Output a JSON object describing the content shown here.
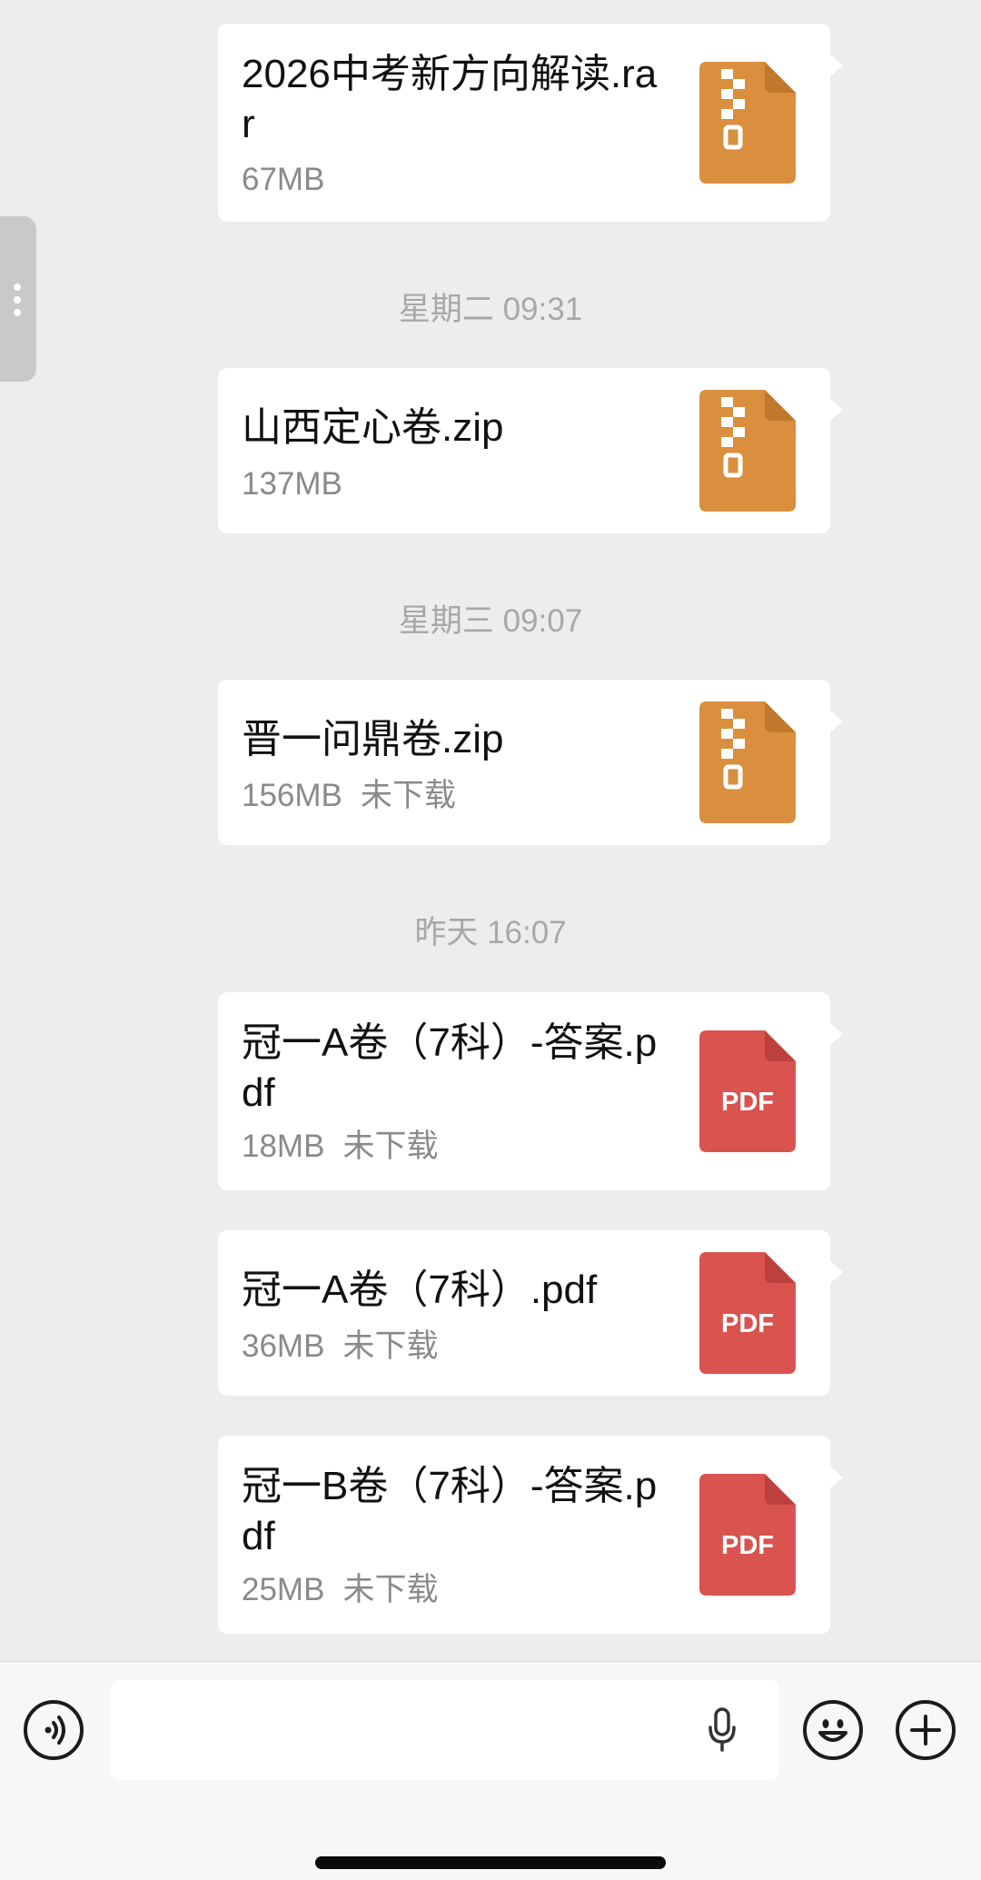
{
  "colors": {
    "chat_background": "#ededed",
    "bubble": "#ffffff",
    "zip_icon": "#d98f3d",
    "pdf_icon": "#d9534f",
    "timestamp": "#a8a8a8",
    "meta_text": "#8a8a8a"
  },
  "messages": [
    {
      "filename": "2026中考新方向解读.rar",
      "size": "67MB",
      "status": "",
      "icon": "zip-archive-icon"
    },
    {
      "filename": "山西定心卷.zip",
      "size": "137MB",
      "status": "",
      "icon": "zip-archive-icon"
    },
    {
      "filename": "晋一问鼎卷.zip",
      "size": "156MB",
      "status": "未下载",
      "icon": "zip-archive-icon"
    },
    {
      "filename": "冠一A卷（7科）-答案.pdf",
      "size": "18MB",
      "status": "未下载",
      "icon": "pdf-file-icon"
    },
    {
      "filename": "冠一A卷（7科）.pdf",
      "size": "36MB",
      "status": "未下载",
      "icon": "pdf-file-icon"
    },
    {
      "filename": "冠一B卷（7科）-答案.pdf",
      "size": "25MB",
      "status": "未下载",
      "icon": "pdf-file-icon"
    }
  ],
  "timestamps": [
    "星期二 09:31",
    "星期三 09:07",
    "昨天 16:07"
  ],
  "pdf_label": "PDF",
  "input": {
    "value": "",
    "placeholder": ""
  },
  "bottom_bar": {
    "icons": [
      "voice-mode-icon",
      "microphone-icon",
      "emoji-icon",
      "plus-icon"
    ]
  }
}
